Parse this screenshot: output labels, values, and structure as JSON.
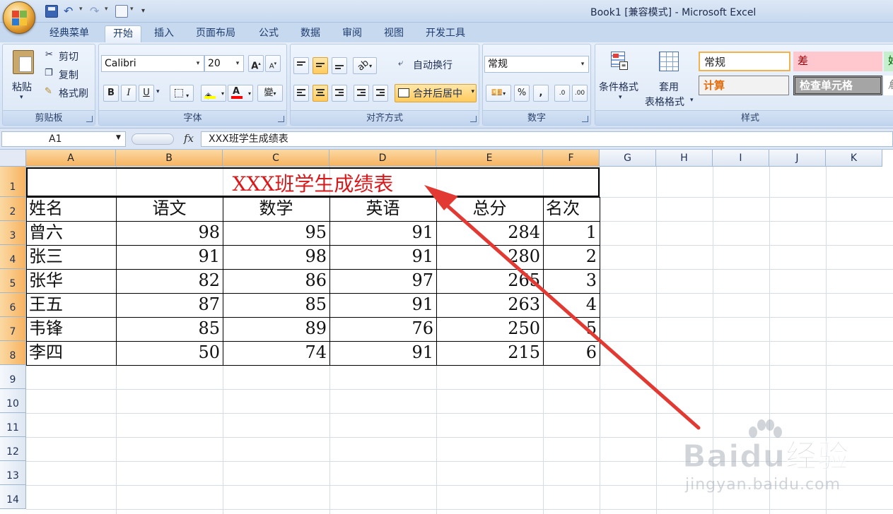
{
  "window": {
    "title": "Book1  [兼容模式] - Microsoft Excel"
  },
  "tabs": [
    "经典菜单",
    "开始",
    "插入",
    "页面布局",
    "公式",
    "数据",
    "审阅",
    "视图",
    "开发工具"
  ],
  "active_tab": "开始",
  "ribbon": {
    "clipboard": {
      "title": "剪贴板",
      "paste": "粘贴",
      "cut": "剪切",
      "copy": "复制",
      "format_painter": "格式刷"
    },
    "font": {
      "title": "字体",
      "name": "Calibri",
      "size": "20",
      "bold": "B",
      "italic": "I",
      "underline": "U",
      "font_color_glyph": "A",
      "grow": "A",
      "shrink": "A",
      "phonetic": "變"
    },
    "alignment": {
      "title": "对齐方式",
      "wrap": "自动换行",
      "merge_center": "合并后居中"
    },
    "number": {
      "title": "数字",
      "format": "常规",
      "percent": "%",
      "comma": ",",
      "inc_decimal": ".0",
      "dec_decimal": ".00"
    },
    "styles": {
      "title": "样式",
      "conditional": "条件格式",
      "table_line1": "套用",
      "table_line2": "表格格式",
      "gallery": [
        {
          "label": "常规"
        },
        {
          "label": "差"
        },
        {
          "label": "好"
        },
        {
          "label": "计算"
        },
        {
          "label": "检查单元格"
        },
        {
          "label": "解"
        }
      ]
    }
  },
  "formula_bar": {
    "cell_ref": "A1",
    "fx": "fx",
    "content": "XXX班学生成绩表"
  },
  "sheet": {
    "columns": [
      "A",
      "B",
      "C",
      "D",
      "E",
      "F",
      "G",
      "H",
      "I",
      "J",
      "K"
    ],
    "rows": [
      "1",
      "2",
      "3",
      "4",
      "5",
      "6",
      "7",
      "8",
      "9",
      "10",
      "11",
      "12",
      "13",
      "14"
    ],
    "title": "XXX班学生成绩表",
    "headers": [
      "姓名",
      "语文",
      "数学",
      "英语",
      "总分",
      "名次"
    ],
    "data": [
      [
        "曾六",
        "98",
        "95",
        "91",
        "284",
        "1"
      ],
      [
        "张三",
        "91",
        "98",
        "91",
        "280",
        "2"
      ],
      [
        "张华",
        "82",
        "86",
        "97",
        "265",
        "3"
      ],
      [
        "王五",
        "87",
        "85",
        "91",
        "263",
        "4"
      ],
      [
        "韦锋",
        "85",
        "89",
        "76",
        "250",
        "5"
      ],
      [
        "李四",
        "50",
        "74",
        "91",
        "215",
        "6"
      ]
    ]
  },
  "watermark": {
    "logo_text": "Baidu经验",
    "url": "jingyan.baidu.com"
  },
  "colors": {
    "title_red": "#d9181b",
    "arrow_red": "#e23a33",
    "bad_fill": "#ffc7ce",
    "check_fill": "#a5a5a5",
    "calc_text": "#e46c0a"
  }
}
